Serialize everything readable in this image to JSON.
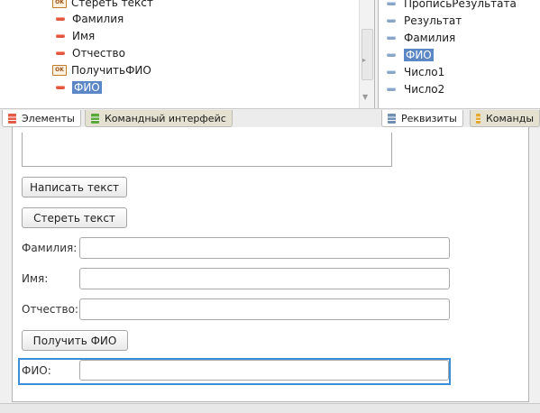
{
  "elements_tree": {
    "items": [
      {
        "label": "Стереть текст",
        "icon": "ok-command-icon"
      },
      {
        "label": "Фамилия",
        "icon": "field-minus-icon"
      },
      {
        "label": "Имя",
        "icon": "field-minus-icon"
      },
      {
        "label": "Отчество",
        "icon": "field-minus-icon"
      },
      {
        "label": "ПолучитьФИО",
        "icon": "ok-command-icon"
      },
      {
        "label": "ФИО",
        "icon": "field-minus-icon",
        "selected": true
      }
    ]
  },
  "attributes_tree": {
    "items": [
      {
        "label": "ПрописьРезультата"
      },
      {
        "label": "Результат"
      },
      {
        "label": "Фамилия"
      },
      {
        "label": "ФИО",
        "selected": true
      },
      {
        "label": "Число1"
      },
      {
        "label": "Число2"
      }
    ]
  },
  "tabs": {
    "elements": "Элементы",
    "command_interface": "Командный интерфейс",
    "attributes": "Реквизиты",
    "commands": "Команды"
  },
  "form": {
    "write_button": "Написать текст",
    "erase_button": "Стереть текст",
    "surname_label": "Фамилия:",
    "name_label": "Имя:",
    "patronymic_label": "Отчество:",
    "get_fio_button": "Получить ФИО",
    "fio_label": "ФИО:"
  },
  "colors": {
    "selection": "#5b87c7",
    "focus": "#3b8fd6",
    "field_icon": "#e25640"
  }
}
